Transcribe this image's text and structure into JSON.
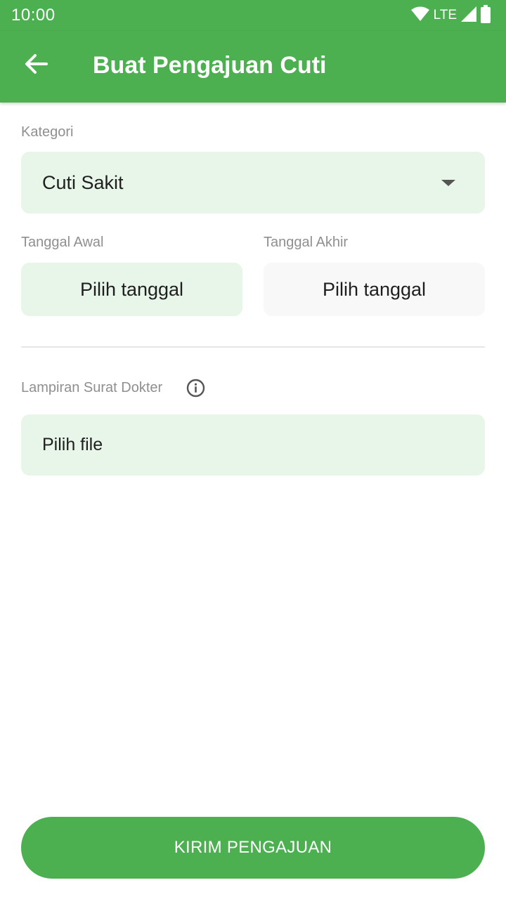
{
  "status_bar": {
    "time": "10:00",
    "network": "LTE"
  },
  "app_bar": {
    "title": "Buat Pengajuan Cuti"
  },
  "form": {
    "category": {
      "label": "Kategori",
      "value": "Cuti Sakit"
    },
    "start_date": {
      "label": "Tanggal Awal",
      "value": "Pilih tanggal"
    },
    "end_date": {
      "label": "Tanggal Akhir",
      "value": "Pilih tanggal"
    },
    "attachment": {
      "label": "Lampiran Surat Dokter",
      "value": "Pilih file"
    }
  },
  "submit": {
    "label": "KIRIM PENGAJUAN"
  },
  "colors": {
    "primary": "#4caf50",
    "field_bg": "#e8f5e9",
    "field_bg_inactive": "#f8f8f8",
    "label": "#8f8f8f"
  }
}
